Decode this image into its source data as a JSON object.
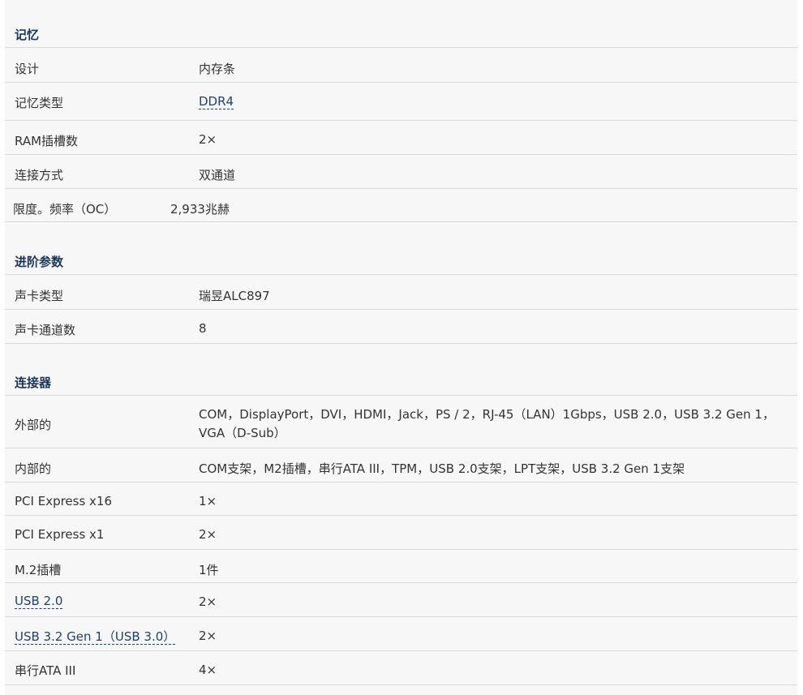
{
  "sections": {
    "memory": {
      "title": "记忆",
      "rows": [
        {
          "key": "设计",
          "value": "内存条"
        },
        {
          "key": "记忆类型",
          "value": "DDR4"
        },
        {
          "key": "RAM插槽数",
          "value": "2×"
        },
        {
          "key": "连接方式",
          "value": "双通道"
        },
        {
          "key": "限度。频率（OC）",
          "value": "2,933兆赫"
        }
      ]
    },
    "advanced": {
      "title": "进阶参数",
      "rows": [
        {
          "key": "声卡类型",
          "value": "瑞昱ALC897"
        },
        {
          "key": "声卡通道数",
          "value": "8"
        }
      ]
    },
    "connectors": {
      "title": "连接器",
      "rows": [
        {
          "key": "外部的",
          "value": "COM，DisplayPort，DVI，HDMI，Jack，PS / 2，RJ-45（LAN）1Gbps，USB 2.0，USB 3.2 Gen 1，VGA（D-Sub）"
        },
        {
          "key": "内部的",
          "value": "COM支架，M2插槽，串行ATA III，TPM，USB 2.0支架，LPT支架，USB 3.2 Gen 1支架"
        },
        {
          "key": "PCI Express x16",
          "value": "1×"
        },
        {
          "key": "PCI Express x1",
          "value": "2×"
        },
        {
          "key": "M.2插槽",
          "value": "1件"
        },
        {
          "key": "USB 2.0",
          "value": "2×"
        },
        {
          "key": "USB 3.2 Gen 1（USB 3.0）",
          "value": "2×"
        },
        {
          "key": "串行ATA III",
          "value": "4×"
        }
      ]
    }
  },
  "colors": {
    "heading": "#1a3558",
    "link": "#1f3f75",
    "background": "#f7f7f7",
    "divider": "#d9d9d9"
  }
}
